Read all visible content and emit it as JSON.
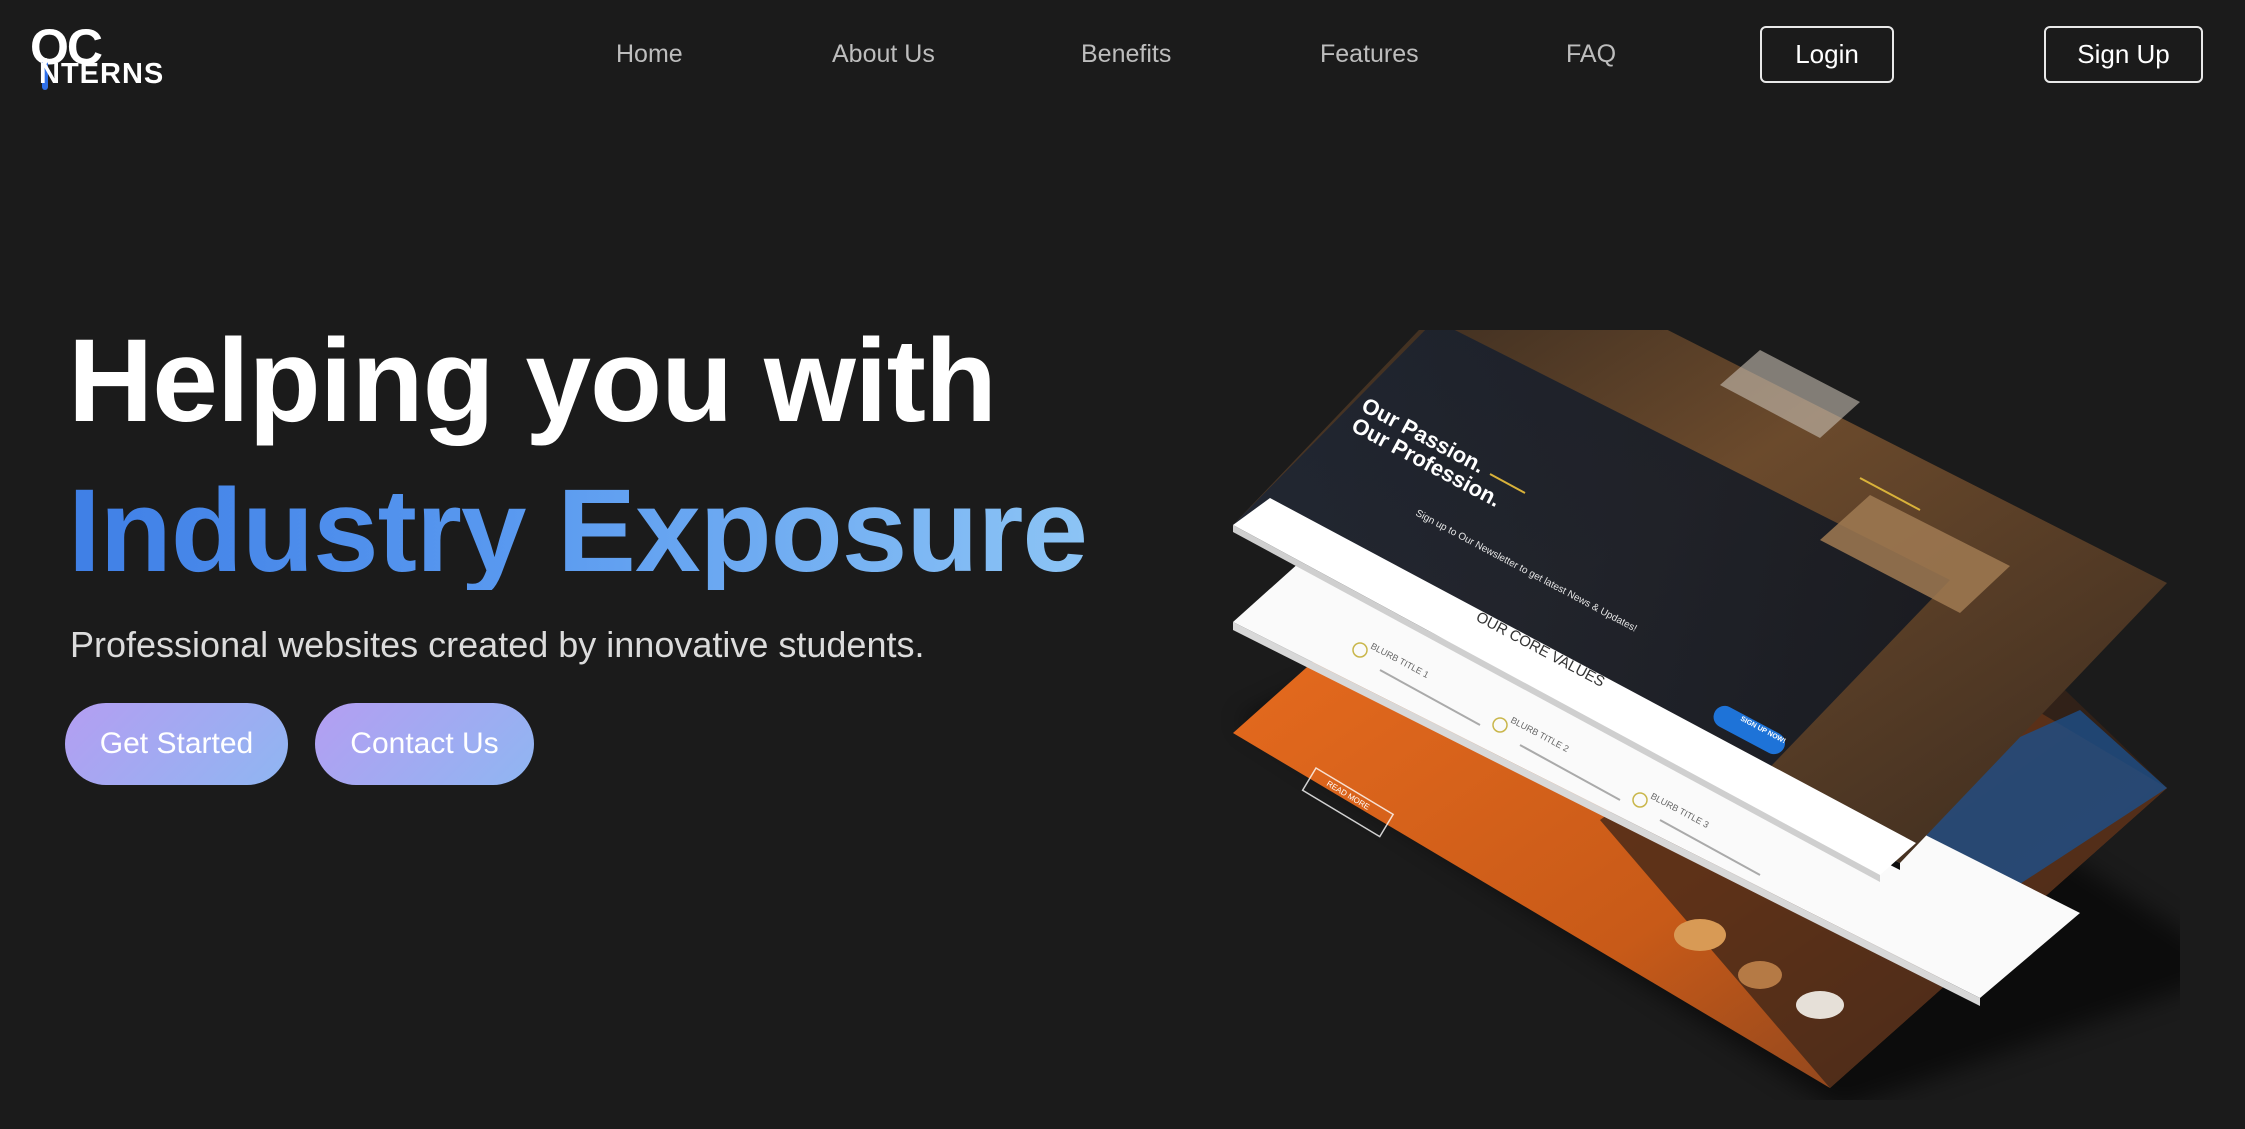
{
  "brand": {
    "logo_top": "OC",
    "logo_bottom": "NTERNS",
    "accent_color": "#2f6fe8"
  },
  "nav": {
    "links": [
      "Home",
      "About Us",
      "Benefits",
      "Features",
      "FAQ"
    ],
    "login": "Login",
    "signup": "Sign Up"
  },
  "hero": {
    "line1": "Helping you with",
    "line2": "Industry Exposure",
    "subtitle": "Professional websites created by innovative students.",
    "cta_primary": "Get Started",
    "cta_secondary": "Contact Us",
    "gradient_colors": [
      "#3f7fe6",
      "#8cc4f5"
    ],
    "button_gradient": [
      "#b49ef2",
      "#8fb6f2"
    ]
  },
  "mockup": {
    "top_title_1": "Our Passion.",
    "top_title_2": "Our Profession.",
    "newsletter": "Sign up to Our Newsletter to get latest News & Updates!",
    "signup_btn": "SIGN UP NOW!",
    "core_values": "OUR CORE VALUES",
    "blurb1": "BLURB TITLE 1",
    "blurb2": "BLURB TITLE 2",
    "blurb3": "BLURB TITLE 3",
    "read_more": "READ MORE"
  }
}
